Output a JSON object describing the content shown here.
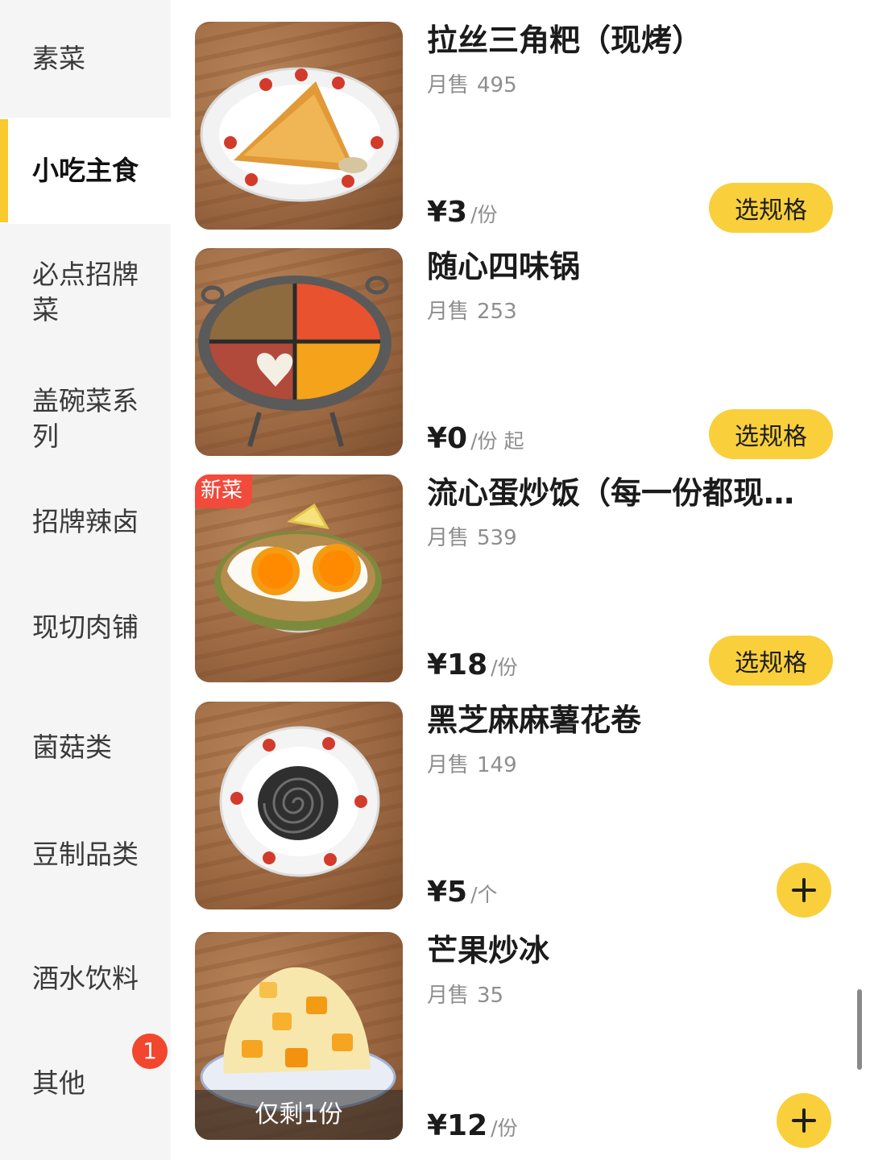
{
  "sidebar": {
    "items": [
      {
        "label": "素菜"
      },
      {
        "label": "小吃主食"
      },
      {
        "label": "必点招牌菜"
      },
      {
        "label": "盖碗菜系列"
      },
      {
        "label": "招牌辣卤"
      },
      {
        "label": "现切肉铺"
      },
      {
        "label": "菌菇类"
      },
      {
        "label": "豆制品类"
      },
      {
        "label": "酒水饮料"
      },
      {
        "label": "其他",
        "badge": "1"
      }
    ],
    "active_index": 1
  },
  "items": [
    {
      "name": "拉丝三角粑（现烤）",
      "sales_label": "月售",
      "sales": "495",
      "price": "¥3",
      "unit": "/份",
      "action": "选规格",
      "image": "triangle-cake-plate"
    },
    {
      "name": "随心四味锅",
      "sales_label": "月售",
      "sales": "253",
      "price": "¥0",
      "unit": "/份",
      "from": "起",
      "action": "选规格",
      "image": "four-flavor-hotpot"
    },
    {
      "name": "流心蛋炒饭（每一份都现…",
      "sales_label": "月售",
      "sales": "539",
      "price": "¥18",
      "unit": "/份",
      "tag": "新菜",
      "action": "选规格",
      "image": "egg-fried-rice"
    },
    {
      "name": "黑芝麻麻薯花卷",
      "sales_label": "月售",
      "sales": "149",
      "price": "¥5",
      "unit": "/个",
      "action": "add",
      "image": "sesame-roll-plate"
    },
    {
      "name": "芒果炒冰",
      "sales_label": "月售",
      "sales": "35",
      "price": "¥12",
      "unit": "/份",
      "stock_label": "仅剩1份",
      "action": "add",
      "image": "mango-shaved-ice"
    }
  ],
  "colors": {
    "accent": "#f9cf3c",
    "badge": "#f2462f",
    "new_tag": "#f24a3b",
    "sidebar_bg": "#f5f5f5",
    "muted_text": "#8e8e8e"
  },
  "icons": {
    "add": "plus-icon"
  }
}
